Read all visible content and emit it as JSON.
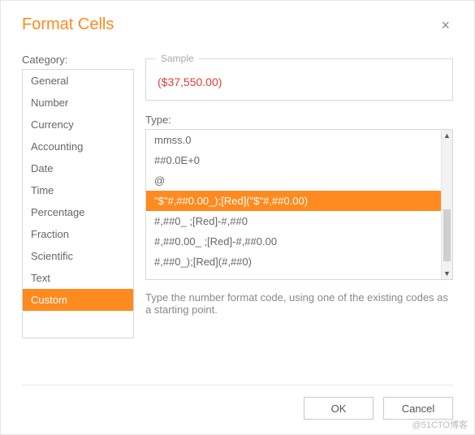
{
  "dialog": {
    "title": "Format Cells",
    "close_glyph": "×"
  },
  "category": {
    "label": "Category:",
    "items": [
      {
        "label": "General"
      },
      {
        "label": "Number"
      },
      {
        "label": "Currency"
      },
      {
        "label": "Accounting"
      },
      {
        "label": "Date"
      },
      {
        "label": "Time"
      },
      {
        "label": "Percentage"
      },
      {
        "label": "Fraction"
      },
      {
        "label": "Scientific"
      },
      {
        "label": "Text"
      },
      {
        "label": "Custom",
        "selected": true
      }
    ]
  },
  "sample": {
    "legend": "Sample",
    "value": "($37,550.00)"
  },
  "type": {
    "label": "Type:",
    "items": [
      {
        "label": "mmss.0"
      },
      {
        "label": "##0.0E+0"
      },
      {
        "label": "@"
      },
      {
        "label": "\"$\"#,##0.00_);[Red](\"$\"#,##0.00)",
        "selected": true
      },
      {
        "label": "#,##0_ ;[Red]-#,##0"
      },
      {
        "label": "#,##0.00_ ;[Red]-#,##0.00"
      },
      {
        "label": "#,##0_);[Red](#,##0)"
      }
    ]
  },
  "hint": "Type the number format code, using one of the existing codes as a starting point.",
  "footer": {
    "ok": "OK",
    "cancel": "Cancel"
  },
  "scroll": {
    "up": "▲",
    "down": "▼"
  },
  "watermark": "@51CTO博客"
}
